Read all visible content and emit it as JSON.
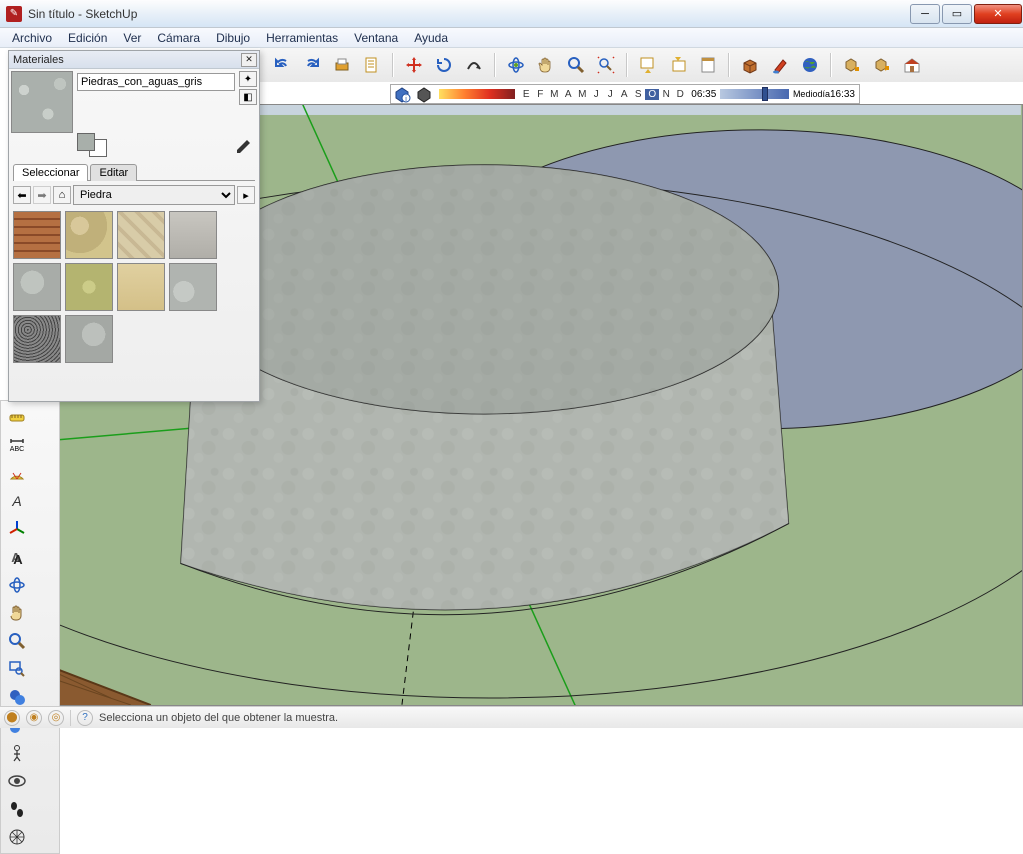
{
  "window": {
    "title": "Sin título - SketchUp"
  },
  "menu": [
    "Archivo",
    "Edición",
    "Ver",
    "Cámara",
    "Dibujo",
    "Herramientas",
    "Ventana",
    "Ayuda"
  ],
  "materials_panel": {
    "title": "Materiales",
    "name_field": "Piedras_con_aguas_gris",
    "tabs": {
      "select": "Seleccionar",
      "edit": "Editar"
    },
    "library_dropdown": "Piedra",
    "swatches": [
      {
        "name": "piedra-ladrillo",
        "bg": "repeating-linear-gradient(0deg,#b57042 0 6px,#8a4a28 6px 8px),repeating-linear-gradient(90deg,rgba(0,0,0,0.15) 0 2px,transparent 2px 18px)"
      },
      {
        "name": "piedra-arena",
        "bg": "radial-gradient(circle at 30% 30%,#d8c89a 0 20%,#c0b07a 20% 60%,#d2c48c 60% 100%)"
      },
      {
        "name": "piedra-pared",
        "bg": "repeating-linear-gradient(45deg,#d8cca8 0 8px,#c8b894 8px 12px)"
      },
      {
        "name": "piedra-losas",
        "bg": "linear-gradient(#c8c6c0,#b0aea8),repeating-linear-gradient(0deg,transparent 0 22px,#888 22px 24px),repeating-linear-gradient(90deg,transparent 0 22px,#888 22px 24px)"
      },
      {
        "name": "piedra-gris1",
        "bg": "radial-gradient(circle at 40% 40%,#bfc4bf 0 30%,#a8aca8 30% 100%)"
      },
      {
        "name": "piedra-verde",
        "bg": "radial-gradient(circle at 50% 50%,#cccc88 0 20%,#b4b470 20% 100%)"
      },
      {
        "name": "piedra-beige",
        "bg": "linear-gradient(#e0d0a0,#d4c088)"
      },
      {
        "name": "piedra-gris2",
        "bg": "radial-gradient(circle at 30% 60%,#c5c9c5 0 25%,#b0b4b0 25% 100%)"
      },
      {
        "name": "piedra-granito",
        "bg": "repeating-radial-gradient(circle at 30% 30%,#444 0 1px,#888 1px 3px)"
      },
      {
        "name": "piedra-gris3",
        "bg": "radial-gradient(circle at 60% 40%,#bcc0bc 0 30%,#a4a8a4 30% 100%)"
      }
    ]
  },
  "shadow": {
    "time_start": "06:35",
    "midday": "Mediodía",
    "time_end": "16:33",
    "months": [
      "E",
      "F",
      "M",
      "A",
      "M",
      "J",
      "J",
      "A",
      "S",
      "O",
      "N",
      "D"
    ]
  },
  "status": {
    "hint": "Selecciona un objeto del que obtener la muestra."
  },
  "icons": {
    "undo": "↶",
    "redo": "↷",
    "cut": "✂",
    "push": "⬆",
    "move": "✥",
    "scale": "⤡",
    "rot": "⟳",
    "offset": "↯",
    "orbit": "🔄",
    "pan": "✋",
    "zoom": "🔍",
    "zoomext": "⊡",
    "prev": "⬇",
    "next": "⬆",
    "model": "📄",
    "component": "📦",
    "paint": "🖌",
    "google": "🌍",
    "upload": "⬆",
    "settings": "⚙",
    "house": "🏠"
  }
}
